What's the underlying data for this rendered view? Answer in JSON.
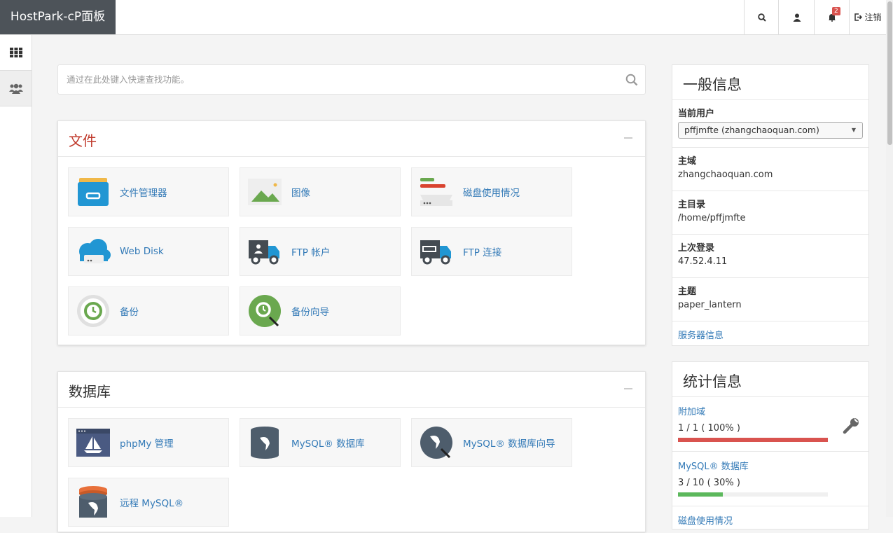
{
  "header": {
    "brand": "HostPark-cP面板",
    "notifications_count": "2",
    "logout_label": "注销"
  },
  "search": {
    "placeholder": "通过在此处键入快速查找功能。"
  },
  "files": {
    "title": "文件",
    "items": [
      "文件管理器",
      "图像",
      "磁盘使用情况",
      "Web Disk",
      "FTP 帐户",
      "FTP 连接",
      "备份",
      "备份向导"
    ]
  },
  "databases": {
    "title": "数据库",
    "items": [
      "phpMy 管理",
      "MySQL® 数据库",
      "MySQL® 数据库向导",
      "远程 MySQL®"
    ]
  },
  "general_info": {
    "title": "一般信息",
    "current_user_label": "当前用户",
    "current_user_value": "pffjmfte (zhangchaoquan.com)",
    "primary_domain_label": "主域",
    "primary_domain_value": "zhangchaoquan.com",
    "home_dir_label": "主目录",
    "home_dir_value": "/home/pffjmfte",
    "last_login_label": "上次登录",
    "last_login_value": "47.52.4.11",
    "theme_label": "主题",
    "theme_value": "paper_lantern",
    "server_info_link": "服务器信息"
  },
  "stats": {
    "title": "统计信息",
    "addon_label": "附加域",
    "addon_value": "1 / 1 ( 100% )",
    "addon_fraction": 1.0,
    "mysql_label": "MySQL® 数据库",
    "mysql_value": "3 / 10 ( 30% )",
    "mysql_fraction": 0.3,
    "disk_label": "磁盘使用情况"
  },
  "colors": {
    "link": "#337ab7",
    "files_title": "#c0392b",
    "bar_red": "#d9534f",
    "bar_green": "#5cb85c"
  }
}
